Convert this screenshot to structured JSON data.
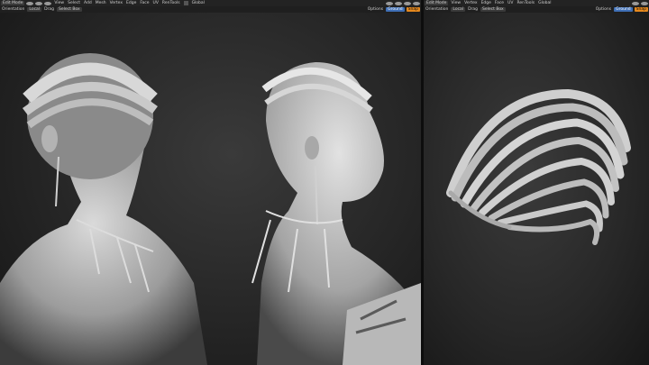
{
  "left_header": {
    "mode": "Edit Mode",
    "menus": [
      "View",
      "Select",
      "Add",
      "Mesh",
      "Vertex",
      "Edge",
      "Face",
      "UV",
      "RenTools"
    ],
    "global": "Global",
    "orientation_label": "Orientation",
    "orientation_value": "Local",
    "drag_label": "Drag",
    "drag_value": "Select Box",
    "options": "Options",
    "snap_label": "Ground",
    "snap_btn": "Snap"
  },
  "right_header": {
    "mode": "Edit Mode",
    "menus": [
      "View",
      "Select",
      "Add",
      "Mesh",
      "Vertex",
      "Edge",
      "Face",
      "UV",
      "RenTools"
    ],
    "global": "Global",
    "orientation_label": "Orientation",
    "orientation_value": "Local",
    "drag_label": "Drag",
    "drag_value": "Select Box",
    "options": "Options",
    "snap_label": "Ground",
    "snap_btn": "Snap"
  },
  "colors": {
    "accent": "#e6891e",
    "select_blue": "#3f6fb6",
    "background": "#1b1b1b"
  }
}
